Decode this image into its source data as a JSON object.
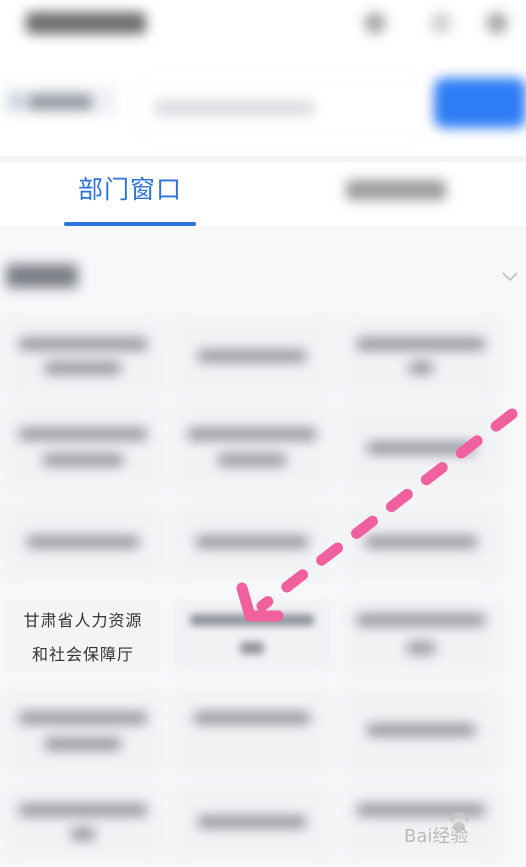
{
  "tabs": [
    {
      "label": "部门窗口",
      "active": true
    }
  ],
  "grid": {
    "highlighted_tile": {
      "line1": "甘肃省人力资源",
      "line2": "和社会保障厅"
    }
  },
  "watermark": {
    "text": "Bai经验"
  },
  "colors": {
    "accent": "#2c73db",
    "search_button": "#2e7cf6",
    "arrow": "#f0609e"
  }
}
